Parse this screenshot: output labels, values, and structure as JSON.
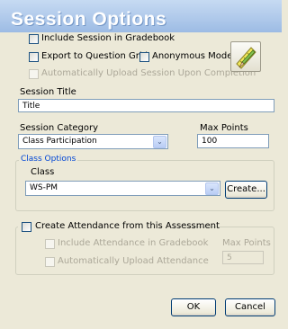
{
  "window": {
    "title": "Session Options"
  },
  "options": {
    "include_gradebook": "Include Session in Gradebook",
    "export_grid": "Export to Question Grid",
    "anonymous_mode": "Anonymous Mode",
    "auto_upload": "Automatically Upload Session Upon Completion"
  },
  "icons": {
    "tool": "pencil-ruler-icon",
    "dropdown": "chevron-down-icon"
  },
  "session_title": {
    "label": "Session Title",
    "value": "Title"
  },
  "session_category": {
    "label": "Session Category",
    "value": "Class Participation"
  },
  "max_points": {
    "label": "Max Points",
    "value": "100"
  },
  "class_options": {
    "legend": "Class Options",
    "class_label": "Class",
    "class_value": "WS-PM",
    "create_button": "Create..."
  },
  "attendance": {
    "create_label": "Create Attendance from this Assessment",
    "include_label": "Include Attendance in Gradebook",
    "upload_label": "Automatically Upload Attendance",
    "max_points_label": "Max Points",
    "max_points_value": "5"
  },
  "buttons": {
    "ok": "OK",
    "cancel": "Cancel"
  }
}
